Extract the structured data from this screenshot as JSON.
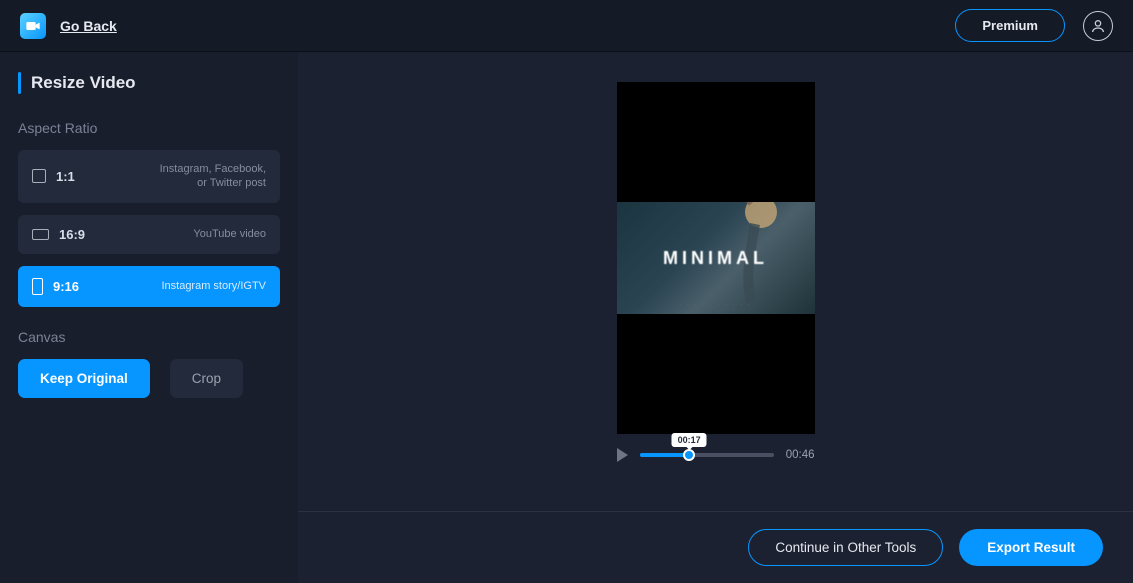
{
  "header": {
    "go_back": "Go Back",
    "premium": "Premium"
  },
  "sidebar": {
    "title": "Resize Video",
    "aspect_label": "Aspect Ratio",
    "ratios": [
      {
        "label": "1:1",
        "desc": "Instagram, Facebook, or Twitter post",
        "active": false,
        "shape": "ratio-11"
      },
      {
        "label": "16:9",
        "desc": "YouTube video",
        "active": false,
        "shape": "ratio-169"
      },
      {
        "label": "9:16",
        "desc": "Instagram story/IGTV",
        "active": true,
        "shape": "ratio-916"
      }
    ],
    "canvas_label": "Canvas",
    "canvas_buttons": [
      {
        "label": "Keep Original",
        "active": true
      },
      {
        "label": "Crop",
        "active": false
      }
    ]
  },
  "preview": {
    "overlay_text": "MINIMAL",
    "current_time": "00:17",
    "duration": "00:46",
    "progress_pct": 37
  },
  "footer": {
    "continue": "Continue in Other Tools",
    "export": "Export Result"
  }
}
